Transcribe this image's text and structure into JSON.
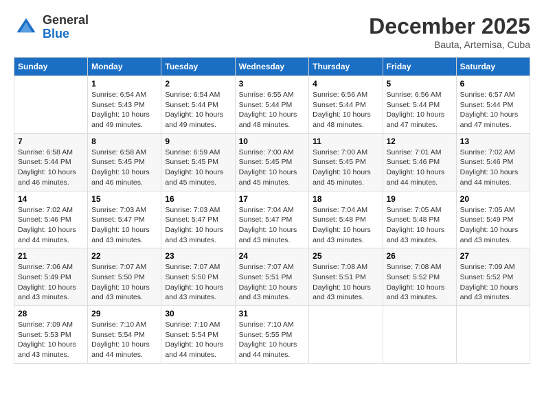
{
  "header": {
    "logo_general": "General",
    "logo_blue": "Blue",
    "month_title": "December 2025",
    "location": "Bauta, Artemisa, Cuba"
  },
  "days_of_week": [
    "Sunday",
    "Monday",
    "Tuesday",
    "Wednesday",
    "Thursday",
    "Friday",
    "Saturday"
  ],
  "weeks": [
    {
      "stripe": "light",
      "days": [
        {
          "num": "",
          "info": ""
        },
        {
          "num": "1",
          "info": "Sunrise: 6:54 AM\nSunset: 5:43 PM\nDaylight: 10 hours\nand 49 minutes."
        },
        {
          "num": "2",
          "info": "Sunrise: 6:54 AM\nSunset: 5:44 PM\nDaylight: 10 hours\nand 49 minutes."
        },
        {
          "num": "3",
          "info": "Sunrise: 6:55 AM\nSunset: 5:44 PM\nDaylight: 10 hours\nand 48 minutes."
        },
        {
          "num": "4",
          "info": "Sunrise: 6:56 AM\nSunset: 5:44 PM\nDaylight: 10 hours\nand 48 minutes."
        },
        {
          "num": "5",
          "info": "Sunrise: 6:56 AM\nSunset: 5:44 PM\nDaylight: 10 hours\nand 47 minutes."
        },
        {
          "num": "6",
          "info": "Sunrise: 6:57 AM\nSunset: 5:44 PM\nDaylight: 10 hours\nand 47 minutes."
        }
      ]
    },
    {
      "stripe": "gray",
      "days": [
        {
          "num": "7",
          "info": "Sunrise: 6:58 AM\nSunset: 5:44 PM\nDaylight: 10 hours\nand 46 minutes."
        },
        {
          "num": "8",
          "info": "Sunrise: 6:58 AM\nSunset: 5:45 PM\nDaylight: 10 hours\nand 46 minutes."
        },
        {
          "num": "9",
          "info": "Sunrise: 6:59 AM\nSunset: 5:45 PM\nDaylight: 10 hours\nand 45 minutes."
        },
        {
          "num": "10",
          "info": "Sunrise: 7:00 AM\nSunset: 5:45 PM\nDaylight: 10 hours\nand 45 minutes."
        },
        {
          "num": "11",
          "info": "Sunrise: 7:00 AM\nSunset: 5:45 PM\nDaylight: 10 hours\nand 45 minutes."
        },
        {
          "num": "12",
          "info": "Sunrise: 7:01 AM\nSunset: 5:46 PM\nDaylight: 10 hours\nand 44 minutes."
        },
        {
          "num": "13",
          "info": "Sunrise: 7:02 AM\nSunset: 5:46 PM\nDaylight: 10 hours\nand 44 minutes."
        }
      ]
    },
    {
      "stripe": "light",
      "days": [
        {
          "num": "14",
          "info": "Sunrise: 7:02 AM\nSunset: 5:46 PM\nDaylight: 10 hours\nand 44 minutes."
        },
        {
          "num": "15",
          "info": "Sunrise: 7:03 AM\nSunset: 5:47 PM\nDaylight: 10 hours\nand 43 minutes."
        },
        {
          "num": "16",
          "info": "Sunrise: 7:03 AM\nSunset: 5:47 PM\nDaylight: 10 hours\nand 43 minutes."
        },
        {
          "num": "17",
          "info": "Sunrise: 7:04 AM\nSunset: 5:47 PM\nDaylight: 10 hours\nand 43 minutes."
        },
        {
          "num": "18",
          "info": "Sunrise: 7:04 AM\nSunset: 5:48 PM\nDaylight: 10 hours\nand 43 minutes."
        },
        {
          "num": "19",
          "info": "Sunrise: 7:05 AM\nSunset: 5:48 PM\nDaylight: 10 hours\nand 43 minutes."
        },
        {
          "num": "20",
          "info": "Sunrise: 7:05 AM\nSunset: 5:49 PM\nDaylight: 10 hours\nand 43 minutes."
        }
      ]
    },
    {
      "stripe": "gray",
      "days": [
        {
          "num": "21",
          "info": "Sunrise: 7:06 AM\nSunset: 5:49 PM\nDaylight: 10 hours\nand 43 minutes."
        },
        {
          "num": "22",
          "info": "Sunrise: 7:07 AM\nSunset: 5:50 PM\nDaylight: 10 hours\nand 43 minutes."
        },
        {
          "num": "23",
          "info": "Sunrise: 7:07 AM\nSunset: 5:50 PM\nDaylight: 10 hours\nand 43 minutes."
        },
        {
          "num": "24",
          "info": "Sunrise: 7:07 AM\nSunset: 5:51 PM\nDaylight: 10 hours\nand 43 minutes."
        },
        {
          "num": "25",
          "info": "Sunrise: 7:08 AM\nSunset: 5:51 PM\nDaylight: 10 hours\nand 43 minutes."
        },
        {
          "num": "26",
          "info": "Sunrise: 7:08 AM\nSunset: 5:52 PM\nDaylight: 10 hours\nand 43 minutes."
        },
        {
          "num": "27",
          "info": "Sunrise: 7:09 AM\nSunset: 5:52 PM\nDaylight: 10 hours\nand 43 minutes."
        }
      ]
    },
    {
      "stripe": "light",
      "days": [
        {
          "num": "28",
          "info": "Sunrise: 7:09 AM\nSunset: 5:53 PM\nDaylight: 10 hours\nand 43 minutes."
        },
        {
          "num": "29",
          "info": "Sunrise: 7:10 AM\nSunset: 5:54 PM\nDaylight: 10 hours\nand 44 minutes."
        },
        {
          "num": "30",
          "info": "Sunrise: 7:10 AM\nSunset: 5:54 PM\nDaylight: 10 hours\nand 44 minutes."
        },
        {
          "num": "31",
          "info": "Sunrise: 7:10 AM\nSunset: 5:55 PM\nDaylight: 10 hours\nand 44 minutes."
        },
        {
          "num": "",
          "info": ""
        },
        {
          "num": "",
          "info": ""
        },
        {
          "num": "",
          "info": ""
        }
      ]
    }
  ]
}
